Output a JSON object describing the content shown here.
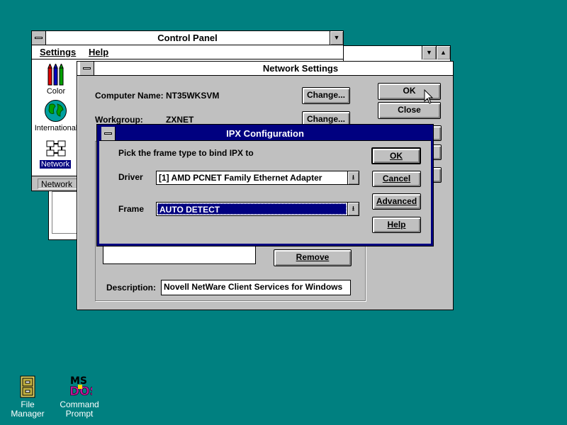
{
  "desktop": {
    "icons": [
      {
        "label": "File Manager",
        "icon": "file-cabinet-icon"
      },
      {
        "label": "Command Prompt",
        "icon": "ms-dos-icon"
      }
    ]
  },
  "background_window": {
    "min_icon": "▼",
    "max_icon": "▲"
  },
  "control_panel": {
    "title": "Control Panel",
    "min_icon": "▼",
    "menu": [
      "Settings",
      "Help"
    ],
    "icons": [
      {
        "label": "Color",
        "icon": "crayons-icon"
      },
      {
        "label": "International",
        "icon": "globe-icon"
      },
      {
        "label": "Network",
        "icon": "network-icon",
        "selected": true
      }
    ],
    "status": "Network"
  },
  "network_settings": {
    "title": "Network Settings",
    "computer_name_label": "Computer Name:",
    "computer_name_value": "NT35WKSVM",
    "workgroup_label": "Workgroup:",
    "workgroup_value": "ZXNET",
    "change_label": "Change...",
    "ok_label": "OK",
    "close_label": "Close",
    "remove_label": "Remove",
    "description_label": "Description:",
    "description_value": "Novell NetWare Client Services for Windows"
  },
  "ipx_dialog": {
    "title": "IPX Configuration",
    "prompt": "Pick the frame type to bind IPX to",
    "driver_label": "Driver",
    "driver_value": "[1]  AMD PCNET Family Ethernet Adapter",
    "frame_label": "Frame",
    "frame_value": "AUTO DETECT",
    "combo_icon": "⭳",
    "ok_label": "OK",
    "cancel_label": "Cancel",
    "advanced_label": "Advanced",
    "help_label": "Help"
  },
  "colors": {
    "desktop": "#008080",
    "active_title": "#000080",
    "face": "#c0c0c0"
  }
}
